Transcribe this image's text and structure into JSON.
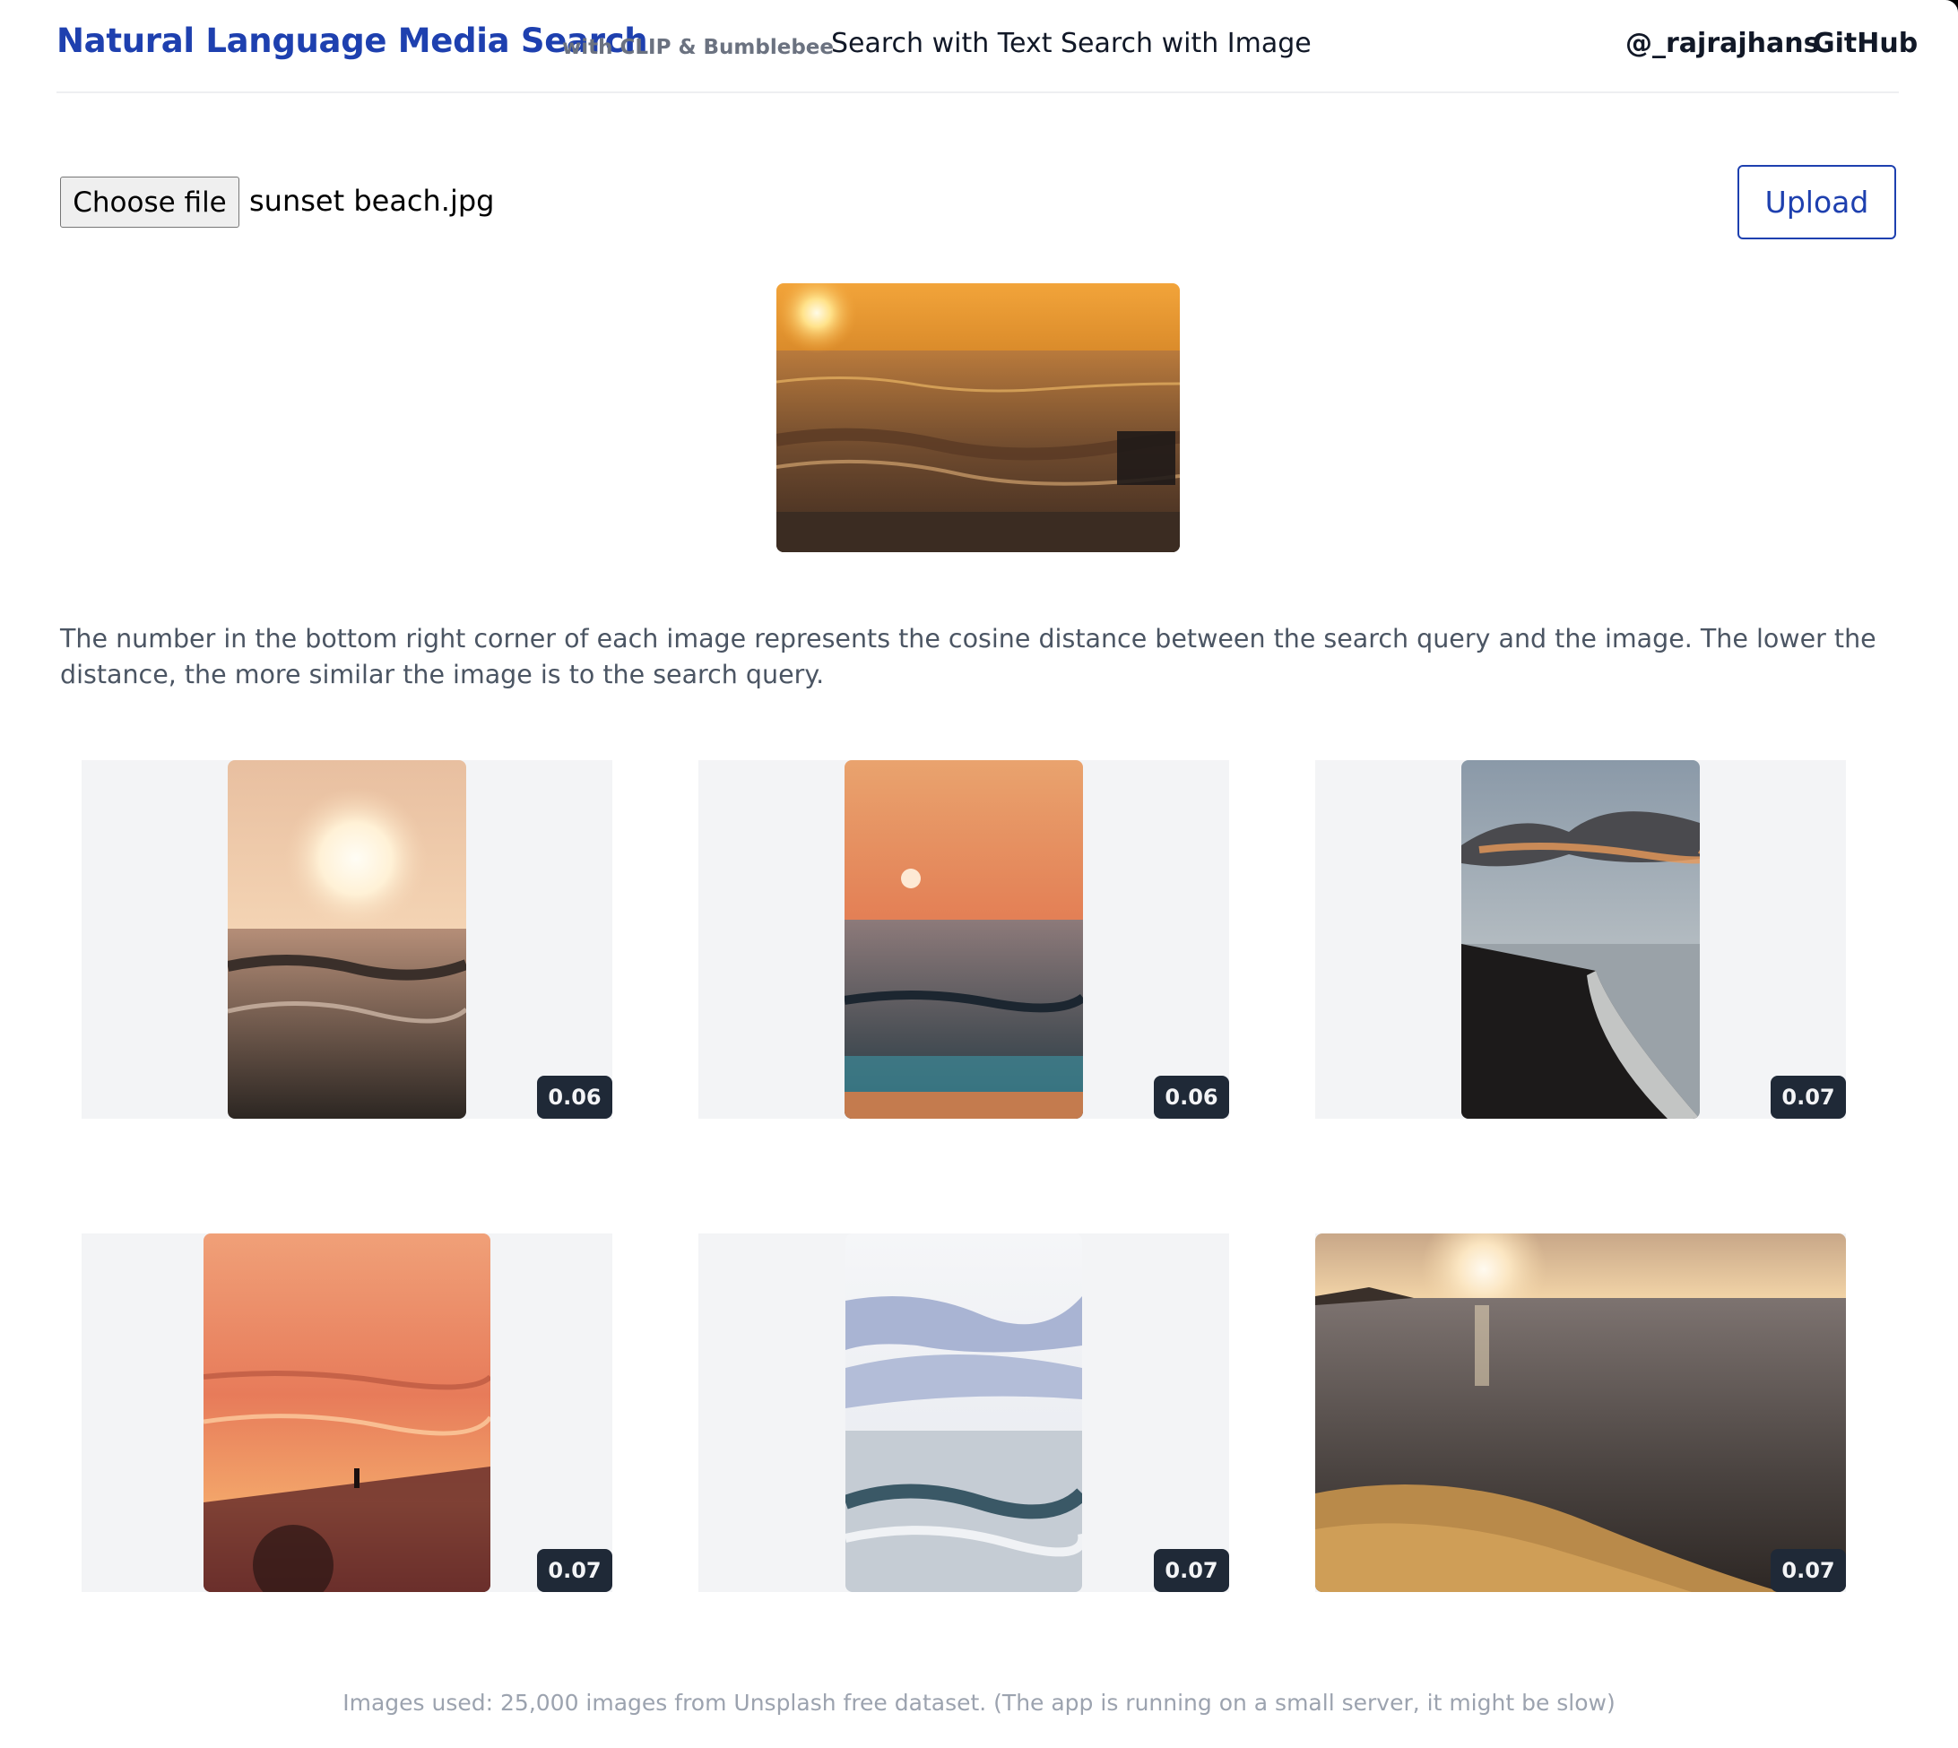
{
  "header": {
    "title": "Natural Language Media Search",
    "subtitle": "with CLIP & Bumblebee",
    "nav": [
      "Search with Text",
      "Search with Image"
    ],
    "links": [
      "@_rajrajhans",
      "GitHub"
    ]
  },
  "upload": {
    "choose_label": "Choose file",
    "file_name": "sunset beach.jpg",
    "upload_label": "Upload"
  },
  "description": "The number in the bottom right corner of each image represents the cosine distance between the search query and the image. The lower the distance, the more similar the image is to the search query.",
  "results": [
    {
      "score": "0.06"
    },
    {
      "score": "0.06"
    },
    {
      "score": "0.07"
    },
    {
      "score": "0.07"
    },
    {
      "score": "0.07"
    },
    {
      "score": "0.07"
    }
  ],
  "footer": "Images used: 25,000 images from Unsplash free dataset. (The app is running on a small server, it might be slow)",
  "colors": {
    "brand": "#1e40af",
    "badge": "#1f2937",
    "card_bg": "#f3f4f6"
  }
}
